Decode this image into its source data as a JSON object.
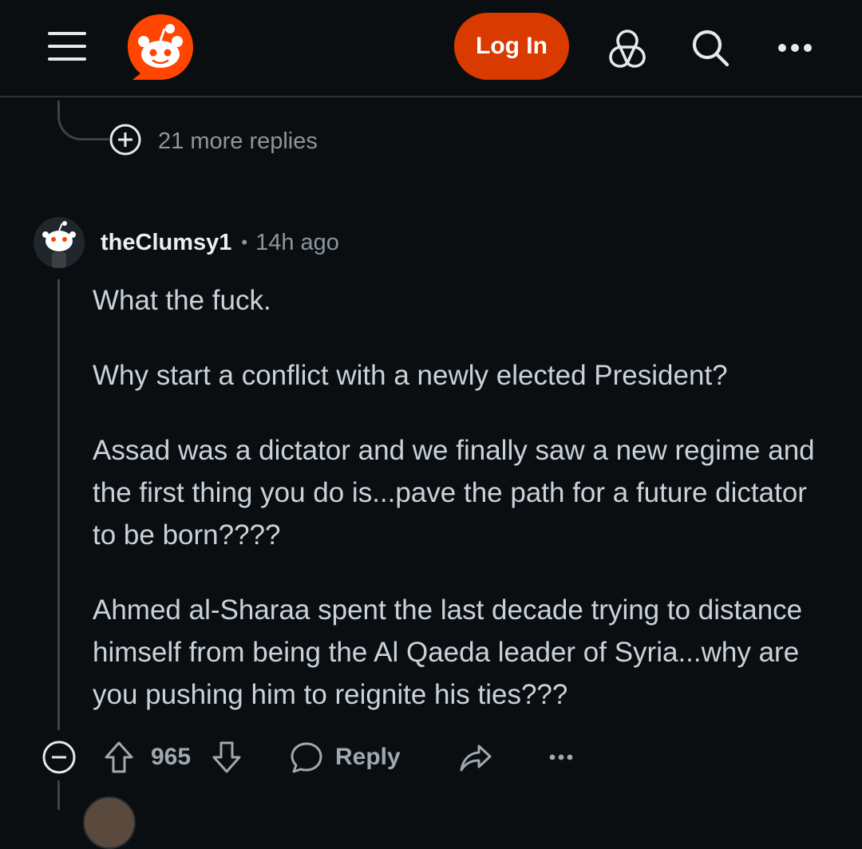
{
  "header": {
    "menu_icon": "hamburger-menu-icon",
    "logo_icon": "reddit-logo-icon",
    "login_label": "Log In",
    "communities_icon": "communities-icon",
    "search_icon": "search-icon",
    "more_icon": "more-options-icon"
  },
  "prev_thread": {
    "more_replies_label": "21 more replies",
    "expand_icon": "plus-circle-icon"
  },
  "comment": {
    "username": "theClumsy1",
    "separator": "•",
    "time": "14h ago",
    "paragraphs": [
      "What the fuck.",
      "Why start a conflict with a newly elected President?",
      "Assad was a dictator and we finally saw a new regime and the first thing you do is...pave the path for a future dictator to be born????",
      "Ahmed al-Sharaa spent the last decade trying to distance himself from being the Al Qaeda leader of Syria...why are you pushing him to reignite his ties???"
    ],
    "score": "965",
    "reply_label": "Reply"
  },
  "colors": {
    "background": "#0b0e11",
    "accent": "#d93a00",
    "text": "#c9d3dc",
    "muted": "#8b969e"
  }
}
